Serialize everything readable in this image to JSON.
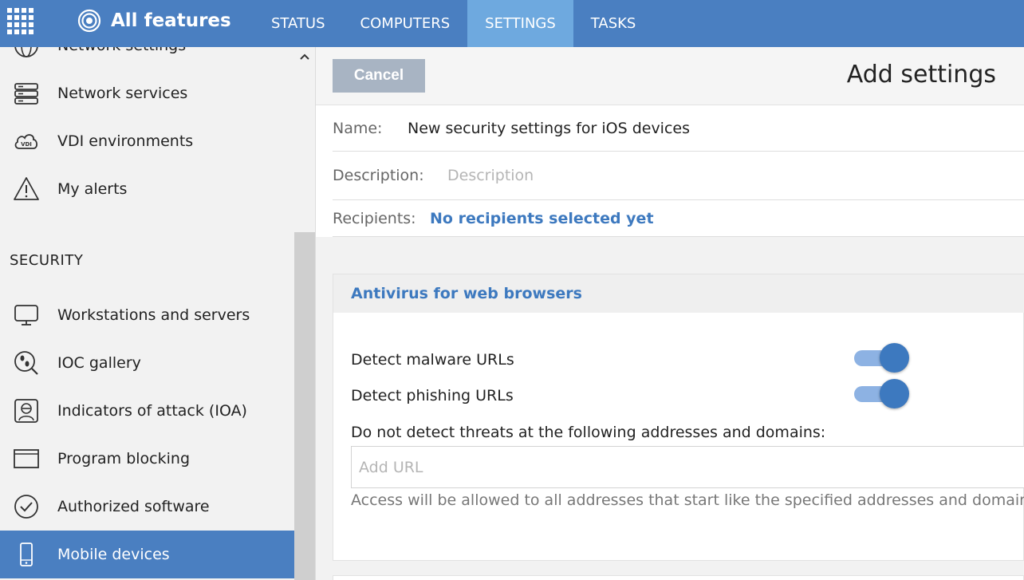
{
  "topbar": {
    "brand_title": "All features",
    "tabs": [
      {
        "label": "STATUS",
        "active": false
      },
      {
        "label": "COMPUTERS",
        "active": false
      },
      {
        "label": "SETTINGS",
        "active": true
      },
      {
        "label": "TASKS",
        "active": false
      }
    ],
    "accent_color": "#4a7fc1",
    "active_tab_color": "#6ea9df"
  },
  "sidebar": {
    "items_top": [
      {
        "label": "Network settings",
        "icon": "globe-icon"
      },
      {
        "label": "Network services",
        "icon": "server-stack-icon"
      },
      {
        "label": "VDI environments",
        "icon": "vdi-cloud-icon"
      },
      {
        "label": "My alerts",
        "icon": "warning-triangle-icon"
      }
    ],
    "section_label": "SECURITY",
    "items_security": [
      {
        "label": "Workstations and servers",
        "icon": "monitor-icon"
      },
      {
        "label": "IOC gallery",
        "icon": "footprint-search-icon"
      },
      {
        "label": "Indicators of attack (IOA)",
        "icon": "hacker-icon"
      },
      {
        "label": "Program blocking",
        "icon": "window-icon"
      },
      {
        "label": "Authorized software",
        "icon": "check-circle-icon"
      },
      {
        "label": "Mobile devices",
        "icon": "mobile-phone-icon",
        "active": true
      }
    ]
  },
  "main": {
    "cancel_label": "Cancel",
    "page_title": "Add settings",
    "name_label": "Name:",
    "name_value": "New security settings for iOS devices",
    "description_label": "Description:",
    "description_placeholder": "Description",
    "recipients_label": "Recipients:",
    "recipients_link": "No recipients selected yet",
    "card": {
      "title": "Antivirus for web browsers",
      "options": [
        {
          "label": "Detect malware URLs",
          "enabled": true
        },
        {
          "label": "Detect phishing URLs",
          "enabled": true
        }
      ],
      "exclusions_label": "Do not detect threats at the following addresses and domains:",
      "url_placeholder": "Add URL",
      "hint": "Access will be allowed to all addresses that start like the specified addresses and domains de"
    }
  }
}
